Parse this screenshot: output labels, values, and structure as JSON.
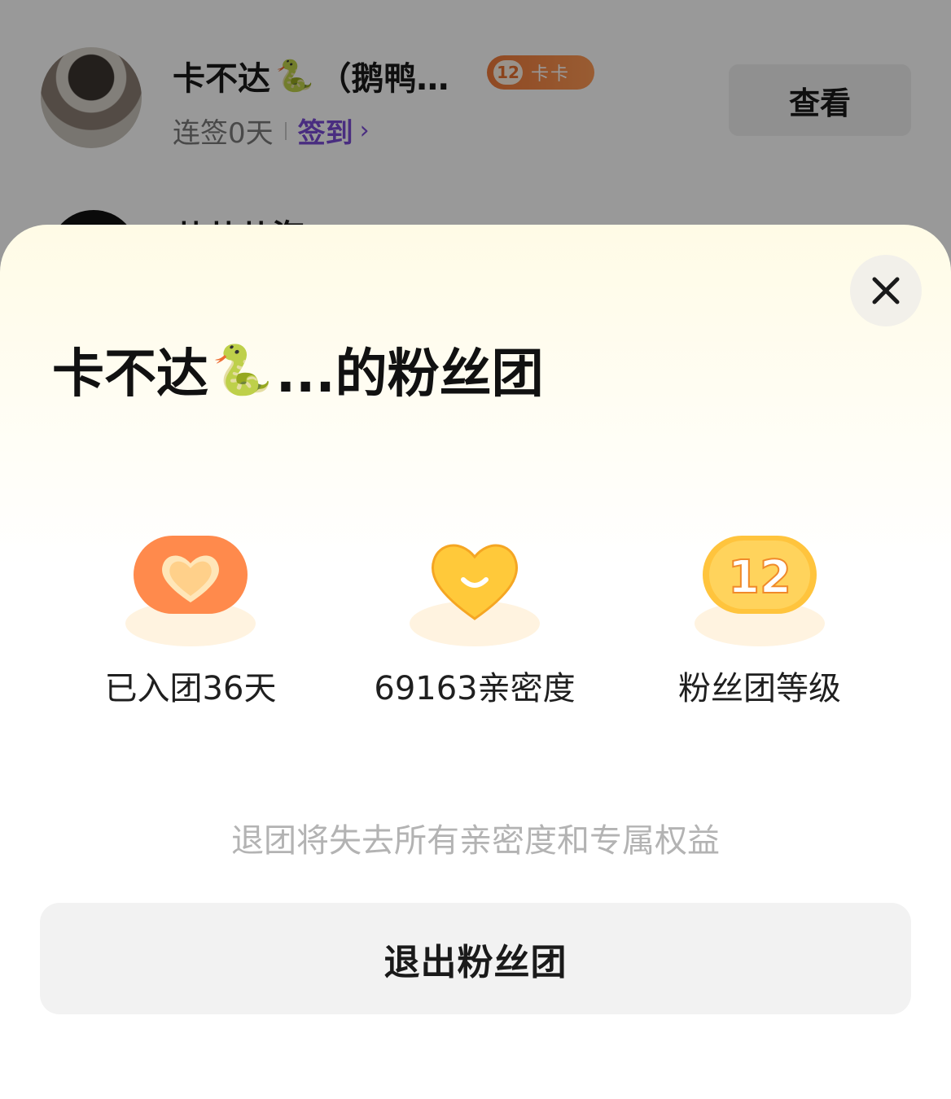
{
  "background": {
    "row1": {
      "name": "卡不达",
      "name_emoji": "🐍",
      "name_suffix": "（鹅鸭…",
      "level_number": "12",
      "level_text": "卡卡",
      "streak": "连签0天",
      "signin": "签到",
      "view_button": "查看"
    },
    "row2": {
      "name_partial": "儿儿儿海"
    }
  },
  "sheet": {
    "title_prefix": "卡不达",
    "title_emoji": "🐍",
    "title_suffix": "...的粉丝团",
    "stats": [
      {
        "label": "已入团36天",
        "icon": "orange-heart-badge-icon"
      },
      {
        "label": "69163亲密度",
        "icon": "smiling-heart-icon"
      },
      {
        "label": "粉丝团等级",
        "icon": "level-badge-icon",
        "badge_number": "12"
      }
    ],
    "warning": "退团将失去所有亲密度和专属权益",
    "leave_button": "退出粉丝团"
  },
  "colors": {
    "accent_purple": "#7b4bd6",
    "badge_orange": "#f07a3a",
    "heart_yellow": "#ffc93a"
  }
}
